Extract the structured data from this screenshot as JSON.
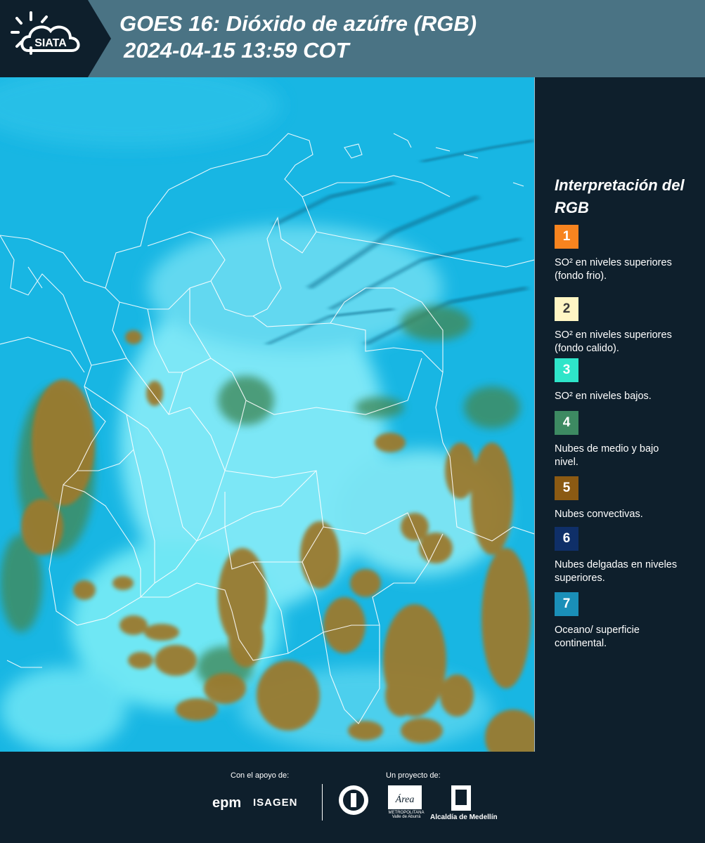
{
  "header": {
    "logo_text": "SIATA",
    "title_line1": "GOES 16: Dióxido de azúfre (RGB)",
    "title_line2": "2024-04-15 13:59 COT",
    "background_color": "#4a7384",
    "logo_background_color": "#0e1f2c"
  },
  "map": {
    "description_icon": "satellite-map",
    "colors": {
      "background_cyan": "#19b8e4",
      "clear_land": "#6fe6f5",
      "convective_brown": "#9b7a2e",
      "low_cloud_green": "#3f8a5c",
      "borders": "#ffffff"
    }
  },
  "legend": {
    "title": "Interpretación del RGB",
    "items": [
      {
        "number": "1",
        "label": "SO² en niveles superiores (fondo frio).",
        "color": "#f7841f"
      },
      {
        "number": "2",
        "label": "SO² en niveles superiores (fondo calido).",
        "color": "#fff6c4"
      },
      {
        "number": "3",
        "label": "SO² en niveles bajos.",
        "color": "#2ee5c9"
      },
      {
        "number": "4",
        "label": "Nubes de medio y bajo nivel.",
        "color": "#3d8a62"
      },
      {
        "number": "5",
        "label": "Nubes convectivas.",
        "color": "#8b5a13"
      },
      {
        "number": "6",
        "label": "Nubes delgadas en niveles superiores.",
        "color": "#0f2f68"
      },
      {
        "number": "7",
        "label": "Oceano/ superficie continental.",
        "color": "#1a8fb8"
      }
    ]
  },
  "footer": {
    "support_caption": "Con el apoyo de:",
    "project_caption": "Un proyecto de:",
    "sponsor_1": "epm",
    "sponsor_2": "ISAGEN",
    "partner_1_text": "Área",
    "partner_1_subtext": "METROPOLITANA Valle de Aburrá",
    "partner_2_text": "Alcaldía de Medellín"
  }
}
